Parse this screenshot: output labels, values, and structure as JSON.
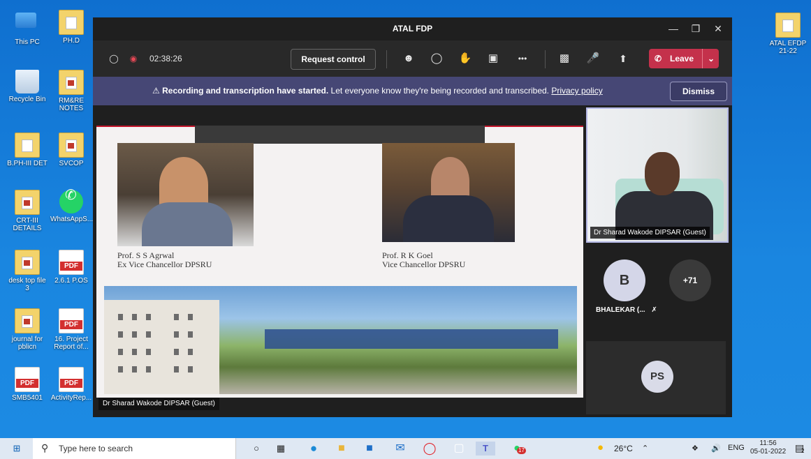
{
  "desktop": {
    "icons": [
      {
        "label": "This PC"
      },
      {
        "label": "PH.D"
      },
      {
        "label": "Recycle Bin"
      },
      {
        "label": "RM&RE NOTES"
      },
      {
        "label": "B.PH-III DET"
      },
      {
        "label": "SVCOP"
      },
      {
        "label": "CRT-III DETAILS"
      },
      {
        "label": "WhatsAppS..."
      },
      {
        "label": "desk top file 3"
      },
      {
        "label": "2.6.1 P.OS"
      },
      {
        "label": "journal for pblicn"
      },
      {
        "label": "16. Project Report of..."
      },
      {
        "label": "SMB5401"
      },
      {
        "label": "ActivityRep..."
      },
      {
        "label": "ATAL EFDP 21-22"
      }
    ],
    "pdf_badge": "PDF"
  },
  "teams": {
    "window_title": "ATAL FDP",
    "timer": "02:38:26",
    "request_control": "Request control",
    "more_label": "•••",
    "leave_label": "Leave",
    "banner": {
      "bold": "Recording and transcription have started.",
      "text": "Let everyone know they're being recorded and transcribed.",
      "link": "Privacy policy",
      "dismiss": "Dismiss"
    },
    "slide": {
      "caption1_name": "Prof. S S Agrwal",
      "caption1_title": "Ex Vice Chancellor DPSRU",
      "caption2_name": "Prof. R K  Goel",
      "caption2_title": "Vice Chancellor DPSRU"
    },
    "presenter_tag": "Dr Sharad Wakode DIPSAR (Guest)",
    "video_tile_name": "Dr Sharad Wakode DIPSAR (Guest)",
    "participants": {
      "b_initial": "B",
      "b_name": "BHALEKAR (...",
      "more_count": "+71",
      "ps_initial": "PS"
    }
  },
  "taskbar": {
    "search_placeholder": "Type here to search",
    "weather": "26°C",
    "language": "ENG",
    "time": "11:56",
    "date": "05-01-2022",
    "notification_count": "2",
    "badge_count": "17"
  }
}
